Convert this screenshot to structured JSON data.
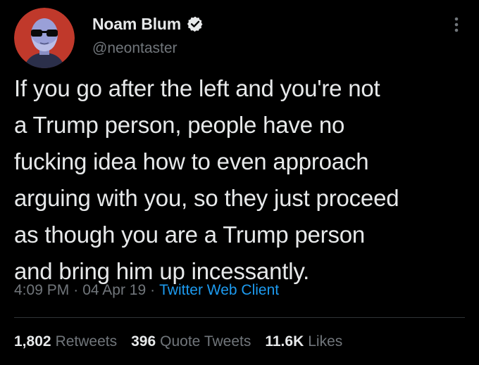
{
  "author": {
    "display_name": "Noam Blum",
    "handle": "@neontaster",
    "avatar_icon": "avatar-sunglasses-icon",
    "verified_icon": "verified-badge-icon"
  },
  "menu": {
    "icon": "more-vertical-icon"
  },
  "tweet": {
    "lines": [
      "If you go after the left and you're not",
      "a Trump person, people have no",
      "fucking idea how to even approach",
      "arguing with you, so they just proceed",
      "as though you are a Trump person",
      "and bring him up incessantly."
    ],
    "time": "4:09 PM",
    "separator": "·",
    "date": "04 Apr 19",
    "client": "Twitter Web Client"
  },
  "stats": {
    "retweets": {
      "count": "1,802",
      "label": "Retweets"
    },
    "quotes": {
      "count": "396",
      "label": "Quote Tweets"
    },
    "likes": {
      "count": "11.6K",
      "label": "Likes"
    }
  },
  "colors": {
    "background": "#000000",
    "text": "#e7e9ea",
    "muted": "#71767b",
    "accent": "#1d9bf0",
    "avatar_bg": "#c0392b",
    "divider": "#2f3336"
  }
}
